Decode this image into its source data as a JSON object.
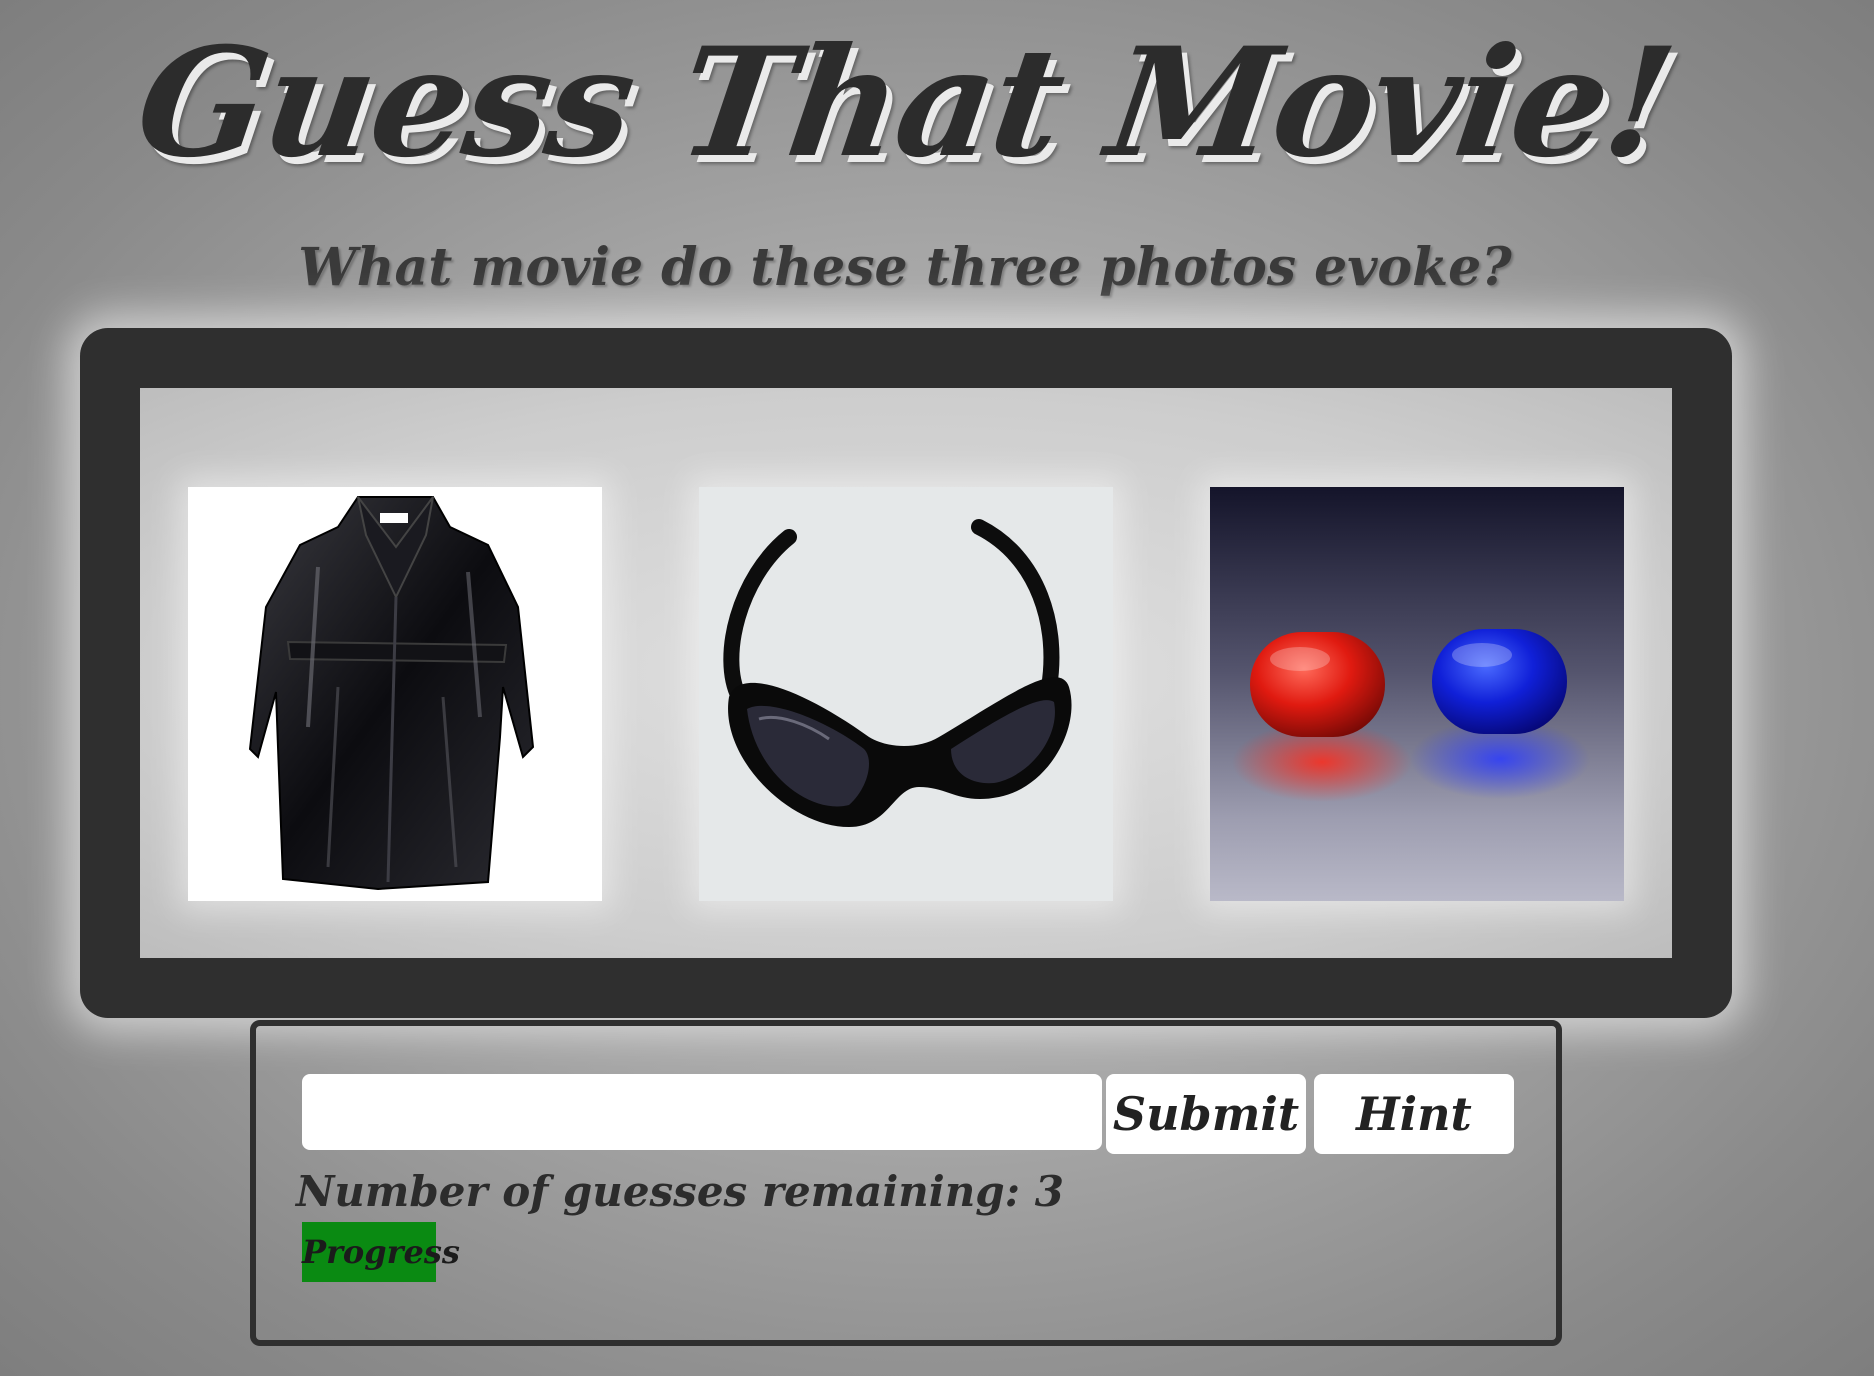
{
  "header": {
    "title": "Guess That Movie!",
    "subtitle": "What movie do these three photos evoke?"
  },
  "photos": [
    {
      "icon": "black-trench-coat-photo"
    },
    {
      "icon": "black-sunglasses-photo"
    },
    {
      "icon": "red-and-blue-pills-photo"
    }
  ],
  "guess": {
    "input_value": "",
    "input_placeholder": "",
    "submit_label": "Submit",
    "hint_label": "Hint",
    "remaining_text": "Number of guesses remaining: 3",
    "progress_label": "Progress",
    "progress_color": "#0a8a12"
  },
  "colors": {
    "frame": "#2f2f2f",
    "text": "#2c2c2c",
    "background": "#a6a6a6"
  }
}
